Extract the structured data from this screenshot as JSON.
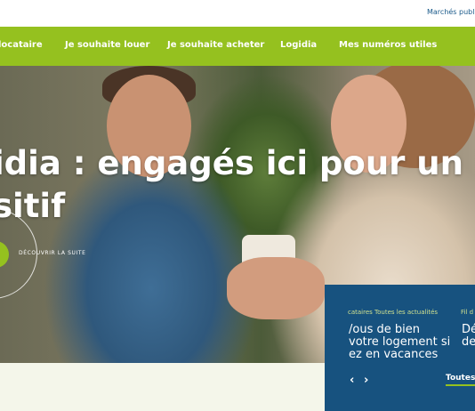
{
  "topbar": {
    "link": "Marchés publi"
  },
  "nav": {
    "items": [
      {
        "label": "locataire"
      },
      {
        "label": "Je souhaite louer"
      },
      {
        "label": "Je souhaite acheter"
      },
      {
        "label": "Logidia"
      },
      {
        "label": "Mes numéros utiles"
      }
    ]
  },
  "hero": {
    "headline_line1": "idia : engagés ici pour un h",
    "headline_line2": "sitif",
    "discover_label": "DÉCOUVRIR LA SUITE"
  },
  "news": {
    "tab1": "cataires  Toutes les actualités",
    "tab2": "Fil d",
    "card1_line1": "/ous de bien",
    "card1_line2": "votre logement si",
    "card1_line3": "ez en vacances",
    "card2_line1": "Dé",
    "card2_line2": "de",
    "prev_symbol": "‹",
    "next_symbol": "›",
    "all_label": "Toutes"
  },
  "colors": {
    "brand_green": "#95c11f",
    "brand_blue": "#17527f"
  }
}
